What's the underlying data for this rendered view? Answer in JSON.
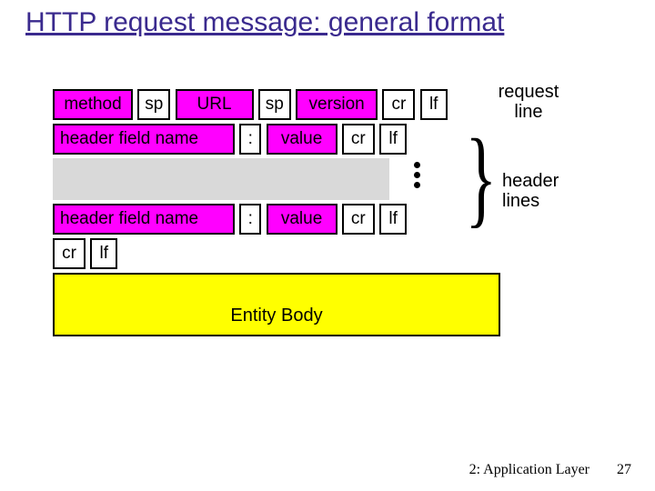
{
  "title": "HTTP request message: general format",
  "row1": {
    "method": "method",
    "sp1": "sp",
    "url": "URL",
    "sp2": "sp",
    "version": "version",
    "cr": "cr",
    "lf": "lf"
  },
  "row2": {
    "hfn": "header field name",
    "colon": ":",
    "value": "value",
    "cr": "cr",
    "lf": "lf"
  },
  "row4": {
    "hfn": "header field name",
    "colon": ":",
    "value": "value",
    "cr": "cr",
    "lf": "lf"
  },
  "row5": {
    "cr": "cr",
    "lf": "lf"
  },
  "body": "Entity Body",
  "annot": {
    "request_line": "request line",
    "header_lines": "header lines"
  },
  "footer": {
    "chapter": "2: Application Layer",
    "page": "27"
  },
  "chart_data": {
    "type": "table",
    "title": "HTTP request message: general format",
    "rows": [
      {
        "name": "request_line",
        "fields": [
          "method",
          "sp",
          "URL",
          "sp",
          "version",
          "cr",
          "lf"
        ],
        "annotation": "request line"
      },
      {
        "name": "header_line",
        "fields": [
          "header field name",
          ":",
          "value",
          "cr",
          "lf"
        ],
        "annotation": "header lines",
        "repeats": true
      },
      {
        "name": "blank_line",
        "fields": [
          "cr",
          "lf"
        ]
      },
      {
        "name": "entity_body",
        "fields": [
          "Entity Body"
        ]
      }
    ]
  }
}
